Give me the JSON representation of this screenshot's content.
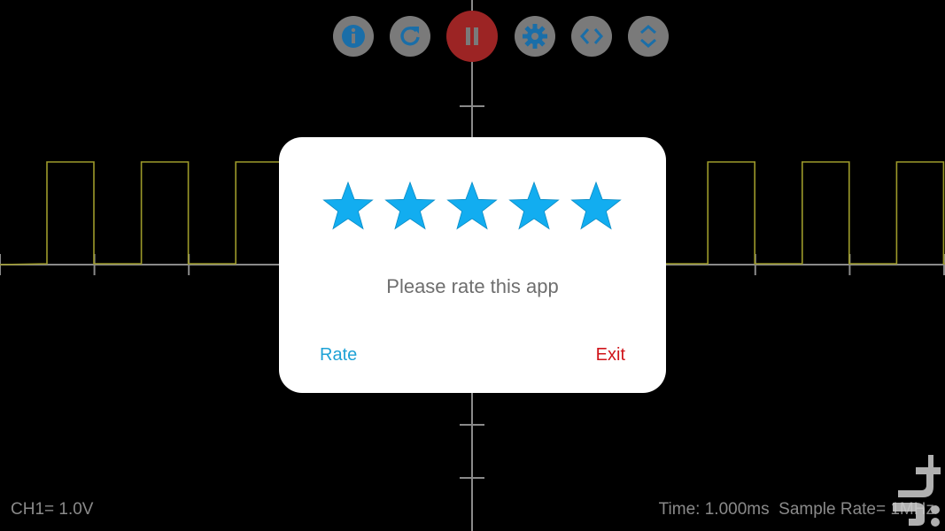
{
  "theme": {
    "background": "#000000",
    "grid_color": "#8a8a8a",
    "trace_color": "#9d9a2a",
    "star_color": "#12adf0",
    "rate_color": "#1ea2d6",
    "exit_color": "#d0141a"
  },
  "toolbar": {
    "buttons": [
      {
        "name": "info-button",
        "icon": "info-icon",
        "bg": "#7a7a7a",
        "fg": "#1a6ea8"
      },
      {
        "name": "reset-button",
        "icon": "refresh-icon",
        "bg": "#7a7a7a",
        "fg": "#1a6ea8"
      },
      {
        "name": "pause-button",
        "icon": "pause-icon",
        "bg": "#9c2424",
        "fg": "#7a7a7a"
      },
      {
        "name": "settings-button",
        "icon": "gear-icon",
        "bg": "#7a7a7a",
        "fg": "#1a6ea8"
      },
      {
        "name": "horizontal-zoom-button",
        "icon": "chevrons-horizontal-icon",
        "bg": "#7a7a7a",
        "fg": "#1a6ea8"
      },
      {
        "name": "vertical-zoom-button",
        "icon": "chevrons-vertical-icon",
        "bg": "#7a7a7a",
        "fg": "#1a6ea8"
      }
    ]
  },
  "status": {
    "channel": "CH1= 1.0V",
    "timing": "Time: 1.000ms  Sample Rate= 1MHz"
  },
  "watermark": {
    "icon": "store-logo-icon"
  },
  "dialog": {
    "star_count": 5,
    "prompt": "Please rate this app",
    "rate_label": "Rate",
    "exit_label": "Exit"
  }
}
